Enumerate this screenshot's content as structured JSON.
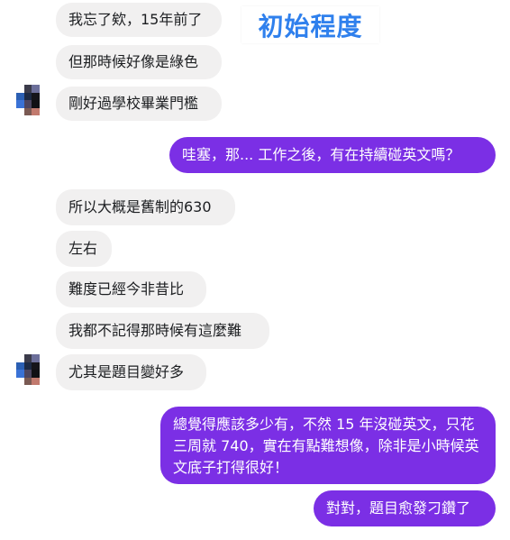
{
  "overlay_title": "初始程度",
  "colors": {
    "incoming_bg": "#f1f0f0",
    "outgoing_bg": "#7b2fe5",
    "title": "#2f80ed"
  },
  "messages": [
    {
      "side": "in",
      "text": "我忘了欸，15年前了"
    },
    {
      "side": "in",
      "text": "但那時候好像是綠色"
    },
    {
      "side": "in",
      "text": "剛好過學校畢業門檻"
    },
    {
      "side": "out",
      "text": "哇塞，那... 工作之後，有在持續碰英文嗎？"
    },
    {
      "side": "in",
      "text": "所以大概是舊制的630"
    },
    {
      "side": "in",
      "text": "左右"
    },
    {
      "side": "in",
      "text": "難度已經今非昔比"
    },
    {
      "side": "in",
      "text": "我都不記得那時候有這麼難"
    },
    {
      "side": "in",
      "text": "尤其是題目變好多"
    },
    {
      "side": "out",
      "text": "總覺得應該多少有，不然 15 年沒碰英文，只花三周就 740，實在有點難想像，除非是小時候英文底子打得很好！"
    },
    {
      "side": "out",
      "text": "對對，題目愈發刁鑽了"
    }
  ]
}
